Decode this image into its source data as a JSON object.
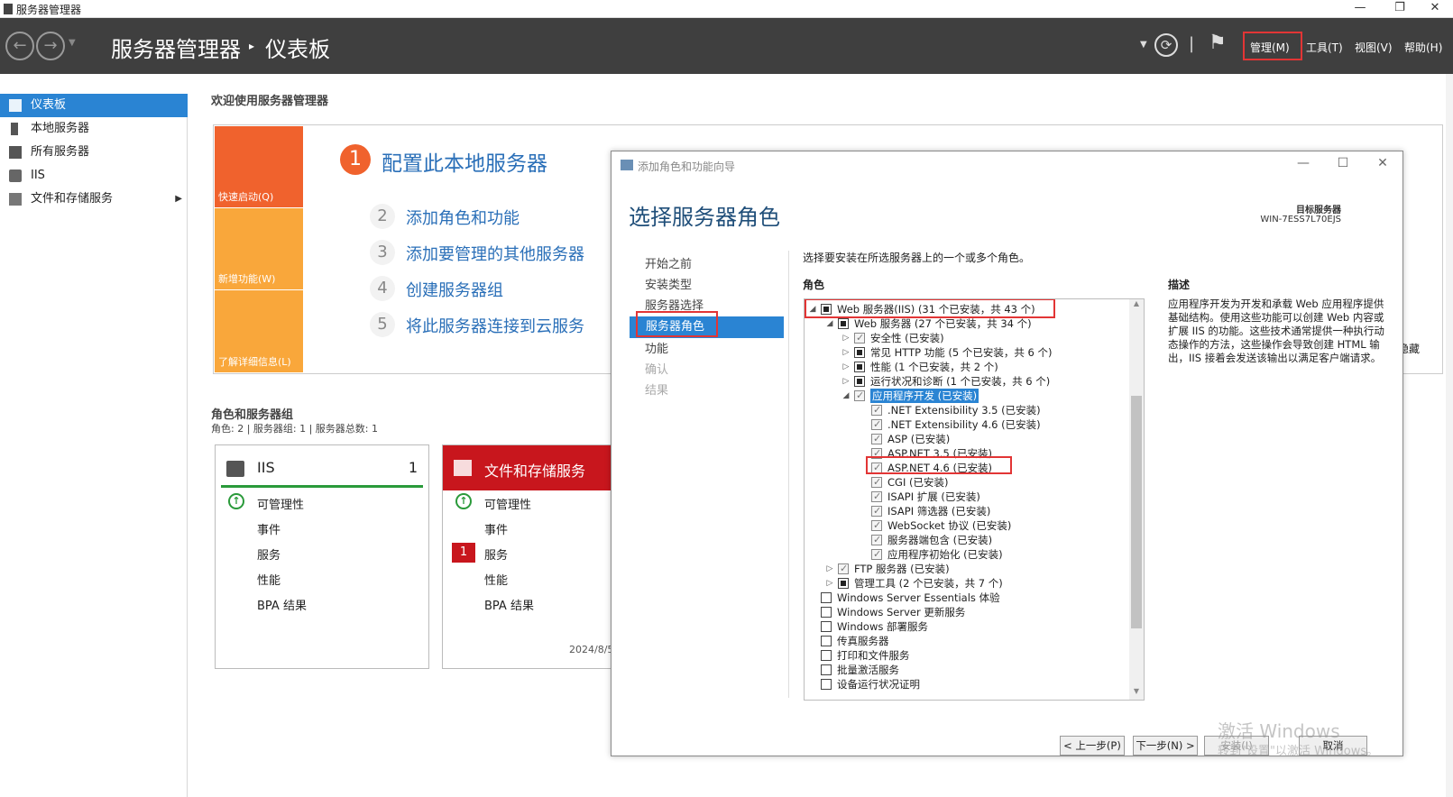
{
  "window": {
    "title": "服务器管理器",
    "controls": [
      "—",
      "❐",
      "✕"
    ]
  },
  "header": {
    "breadcrumb_app": "服务器管理器",
    "breadcrumb_page": "仪表板",
    "menus": [
      "管理(M)",
      "工具(T)",
      "视图(V)",
      "帮助(H)"
    ]
  },
  "sidebar": {
    "items": [
      {
        "label": "仪表板",
        "icon": "dashboard-icon",
        "active": true
      },
      {
        "label": "本地服务器",
        "icon": "server-icon"
      },
      {
        "label": "所有服务器",
        "icon": "servers-icon"
      },
      {
        "label": "IIS",
        "icon": "iis-icon"
      },
      {
        "label": "文件和存储服务",
        "icon": "storage-icon",
        "has_submenu": true
      }
    ]
  },
  "dashboard": {
    "welcome": "欢迎使用服务器管理器",
    "tiles": [
      "快速启动(Q)",
      "新增功能(W)",
      "了解详细信息(L)"
    ],
    "steps": [
      {
        "num": "1",
        "label": "配置此本地服务器"
      },
      {
        "num": "2",
        "label": "添加角色和功能"
      },
      {
        "num": "3",
        "label": "添加要管理的其他服务器"
      },
      {
        "num": "4",
        "label": "创建服务器组"
      },
      {
        "num": "5",
        "label": "将此服务器连接到云服务"
      }
    ],
    "hide_label": "隐藏",
    "groups_title": "角色和服务器组",
    "groups_summary": "角色: 2 | 服务器组: 1 | 服务器总数: 1",
    "cards": [
      {
        "name": "IIS",
        "count": "1",
        "rows": [
          "可管理性",
          "事件",
          "服务",
          "性能",
          "BPA 结果"
        ],
        "services_badge": ""
      },
      {
        "name": "文件和存储服务",
        "count": "",
        "rows": [
          "可管理性",
          "事件",
          "服务",
          "性能",
          "BPA 结果"
        ],
        "services_badge": "1",
        "date": "2024/8/5"
      }
    ]
  },
  "wizard": {
    "title": "添加角色和功能向导",
    "heading": "选择服务器角色",
    "target_label": "目标服务器",
    "target_value": "WIN-7ESS7L70EJS",
    "steps": [
      "开始之前",
      "安装类型",
      "服务器选择",
      "服务器角色",
      "功能",
      "确认",
      "结果"
    ],
    "instruction": "选择要安装在所选服务器上的一个或多个角色。",
    "roles_label": "角色",
    "description_label": "描述",
    "description": "应用程序开发为开发和承载 Web 应用程序提供基础结构。使用这些功能可以创建 Web 内容或扩展 IIS 的功能。这些技术通常提供一种执行动态操作的方法，这些操作会导致创建 HTML 输出，IIS 接着会发送该输出以满足客户端请求。",
    "tree": [
      {
        "label": "Web 服务器(IIS) (31 个已安装，共 43 个)",
        "level": 0,
        "exp": "◢",
        "state": "ind"
      },
      {
        "label": "Web 服务器 (27 个已安装，共 34 个)",
        "level": 1,
        "exp": "◢",
        "state": "ind"
      },
      {
        "label": "安全性 (已安装)",
        "level": 2,
        "exp": "▷",
        "state": "chk"
      },
      {
        "label": "常见 HTTP 功能 (5 个已安装，共 6 个)",
        "level": 2,
        "exp": "▷",
        "state": "ind"
      },
      {
        "label": "性能 (1 个已安装，共 2 个)",
        "level": 2,
        "exp": "▷",
        "state": "ind"
      },
      {
        "label": "运行状况和诊断 (1 个已安装，共 6 个)",
        "level": 2,
        "exp": "▷",
        "state": "ind"
      },
      {
        "label": "应用程序开发 (已安装)",
        "level": 2,
        "exp": "◢",
        "state": "chk",
        "selected": true
      },
      {
        "label": ".NET Extensibility 3.5 (已安装)",
        "level": 3,
        "exp": "",
        "state": "chk"
      },
      {
        "label": ".NET Extensibility 4.6 (已安装)",
        "level": 3,
        "exp": "",
        "state": "chk"
      },
      {
        "label": "ASP (已安装)",
        "level": 3,
        "exp": "",
        "state": "chk"
      },
      {
        "label": "ASP.NET 3.5 (已安装)",
        "level": 3,
        "exp": "",
        "state": "chk"
      },
      {
        "label": "ASP.NET 4.6 (已安装)",
        "level": 3,
        "exp": "",
        "state": "chk"
      },
      {
        "label": "CGI (已安装)",
        "level": 3,
        "exp": "",
        "state": "chk"
      },
      {
        "label": "ISAPI 扩展 (已安装)",
        "level": 3,
        "exp": "",
        "state": "chk"
      },
      {
        "label": "ISAPI 筛选器 (已安装)",
        "level": 3,
        "exp": "",
        "state": "chk"
      },
      {
        "label": "WebSocket 协议 (已安装)",
        "level": 3,
        "exp": "",
        "state": "chk"
      },
      {
        "label": "服务器端包含 (已安装)",
        "level": 3,
        "exp": "",
        "state": "chk"
      },
      {
        "label": "应用程序初始化 (已安装)",
        "level": 3,
        "exp": "",
        "state": "chk"
      },
      {
        "label": "FTP 服务器 (已安装)",
        "level": 1,
        "exp": "▷",
        "state": "chk"
      },
      {
        "label": "管理工具 (2 个已安装，共 7 个)",
        "level": 1,
        "exp": "▷",
        "state": "ind"
      },
      {
        "label": "Windows Server Essentials 体验",
        "level": 0,
        "exp": "",
        "state": ""
      },
      {
        "label": "Windows Server 更新服务",
        "level": 0,
        "exp": "",
        "state": ""
      },
      {
        "label": "Windows 部署服务",
        "level": 0,
        "exp": "",
        "state": ""
      },
      {
        "label": "传真服务器",
        "level": 0,
        "exp": "",
        "state": ""
      },
      {
        "label": "打印和文件服务",
        "level": 0,
        "exp": "",
        "state": ""
      },
      {
        "label": "批量激活服务",
        "level": 0,
        "exp": "",
        "state": ""
      },
      {
        "label": "设备运行状况证明",
        "level": 0,
        "exp": "",
        "state": ""
      }
    ],
    "buttons": {
      "prev": "< 上一步(P)",
      "next": "下一步(N) >",
      "install": "安装(I)",
      "cancel": "取消"
    }
  },
  "watermark": {
    "line1": "激活 Windows",
    "line2": "转到\"设置\"以激活 Windows。"
  },
  "colors": {
    "accent": "#2a84d3",
    "header": "#3f3f3f",
    "tile1": "#f0622d",
    "tile2": "#f9a73b",
    "alert": "#c8161d",
    "highlight": "#e23535"
  }
}
